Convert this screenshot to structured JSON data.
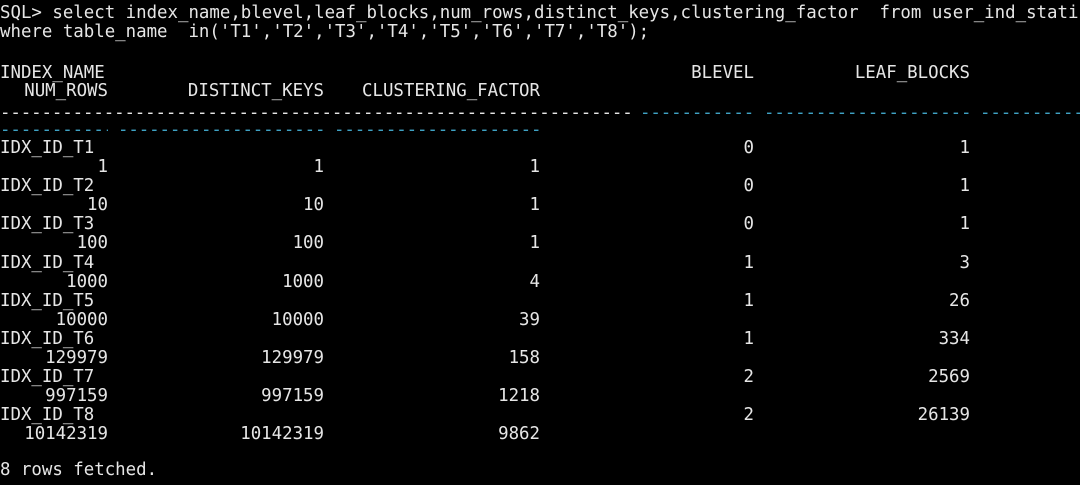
{
  "terminal": {
    "command_line1": "SQL> select index_name,blevel,leaf_blocks,num_rows,distinct_keys,clustering_factor  from user_ind_statistics",
    "command_line2": "where table_name  in('T1','T2','T3','T4','T5','T6','T7','T8');",
    "headers": {
      "index_name": "INDEX_NAME",
      "blevel": "BLEVEL",
      "leaf_blocks": "LEAF_BLOCKS",
      "num_rows": "NUM_ROWS",
      "distinct_keys": "DISTINCT_KEYS",
      "clustering_factor": "CLUSTERING_FACTOR"
    },
    "rows": [
      {
        "index_name": "IDX_ID_T1",
        "blevel": "0",
        "leaf_blocks": "1",
        "num_rows": "1",
        "distinct_keys": "1",
        "clustering_factor": "1"
      },
      {
        "index_name": "IDX_ID_T2",
        "blevel": "0",
        "leaf_blocks": "1",
        "num_rows": "10",
        "distinct_keys": "10",
        "clustering_factor": "1"
      },
      {
        "index_name": "IDX_ID_T3",
        "blevel": "0",
        "leaf_blocks": "1",
        "num_rows": "100",
        "distinct_keys": "100",
        "clustering_factor": "1"
      },
      {
        "index_name": "IDX_ID_T4",
        "blevel": "1",
        "leaf_blocks": "3",
        "num_rows": "1000",
        "distinct_keys": "1000",
        "clustering_factor": "4"
      },
      {
        "index_name": "IDX_ID_T5",
        "blevel": "1",
        "leaf_blocks": "26",
        "num_rows": "10000",
        "distinct_keys": "10000",
        "clustering_factor": "39"
      },
      {
        "index_name": "IDX_ID_T6",
        "blevel": "1",
        "leaf_blocks": "334",
        "num_rows": "129979",
        "distinct_keys": "129979",
        "clustering_factor": "158"
      },
      {
        "index_name": "IDX_ID_T7",
        "blevel": "2",
        "leaf_blocks": "2569",
        "num_rows": "997159",
        "distinct_keys": "997159",
        "clustering_factor": "1218"
      },
      {
        "index_name": "IDX_ID_T8",
        "blevel": "2",
        "leaf_blocks": "26139",
        "num_rows": "10142319",
        "distinct_keys": "10142319",
        "clustering_factor": "9862"
      }
    ],
    "footer": "8 rows fetched.",
    "colors": {
      "background": "#000000",
      "text": "#e6e6e6",
      "separator": "#3fa2c4"
    }
  }
}
